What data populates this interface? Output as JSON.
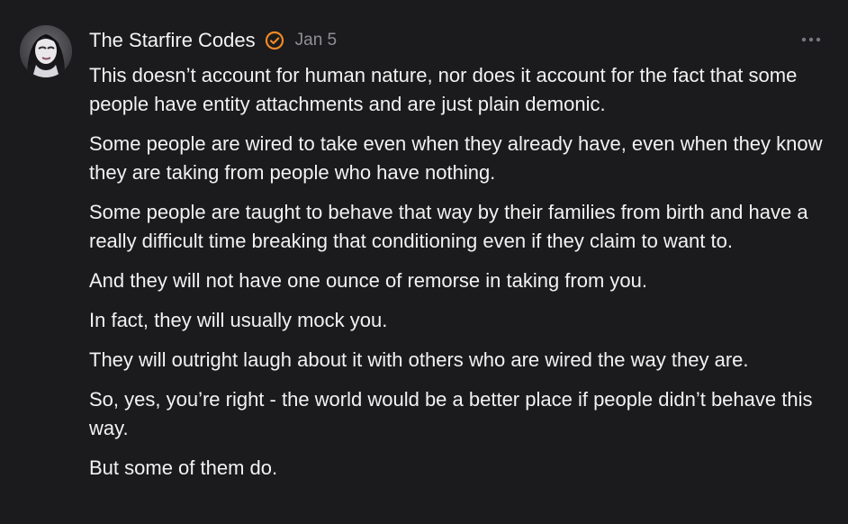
{
  "comment": {
    "author": "The Starfire Codes",
    "date": "Jan 5",
    "verified_icon": "verified-badge-icon",
    "more_icon": "more-horizontal-icon",
    "avatar_icon": "avatar",
    "paragraphs": [
      "This doesn’t account for human nature, nor does it account for the fact that some people have entity attachments and are just plain demonic.",
      "Some people are wired to take even when they already have, even when they know they are taking from people who have nothing.",
      "Some people are taught to behave that way by their families from birth and have a really difficult time breaking that conditioning even if they claim to want to.",
      "And they will not have one ounce of remorse in taking from you.",
      "In fact, they will usually mock you.",
      "They will outright laugh about it with others who are wired the way they are.",
      "So, yes, you’re right - the world would be a better place if people didn’t behave this way.",
      "But some of them do."
    ],
    "colors": {
      "background": "#1b1b1d",
      "text": "#f2f2f2",
      "muted": "#8f8f95",
      "accent": "#f08a24"
    }
  }
}
